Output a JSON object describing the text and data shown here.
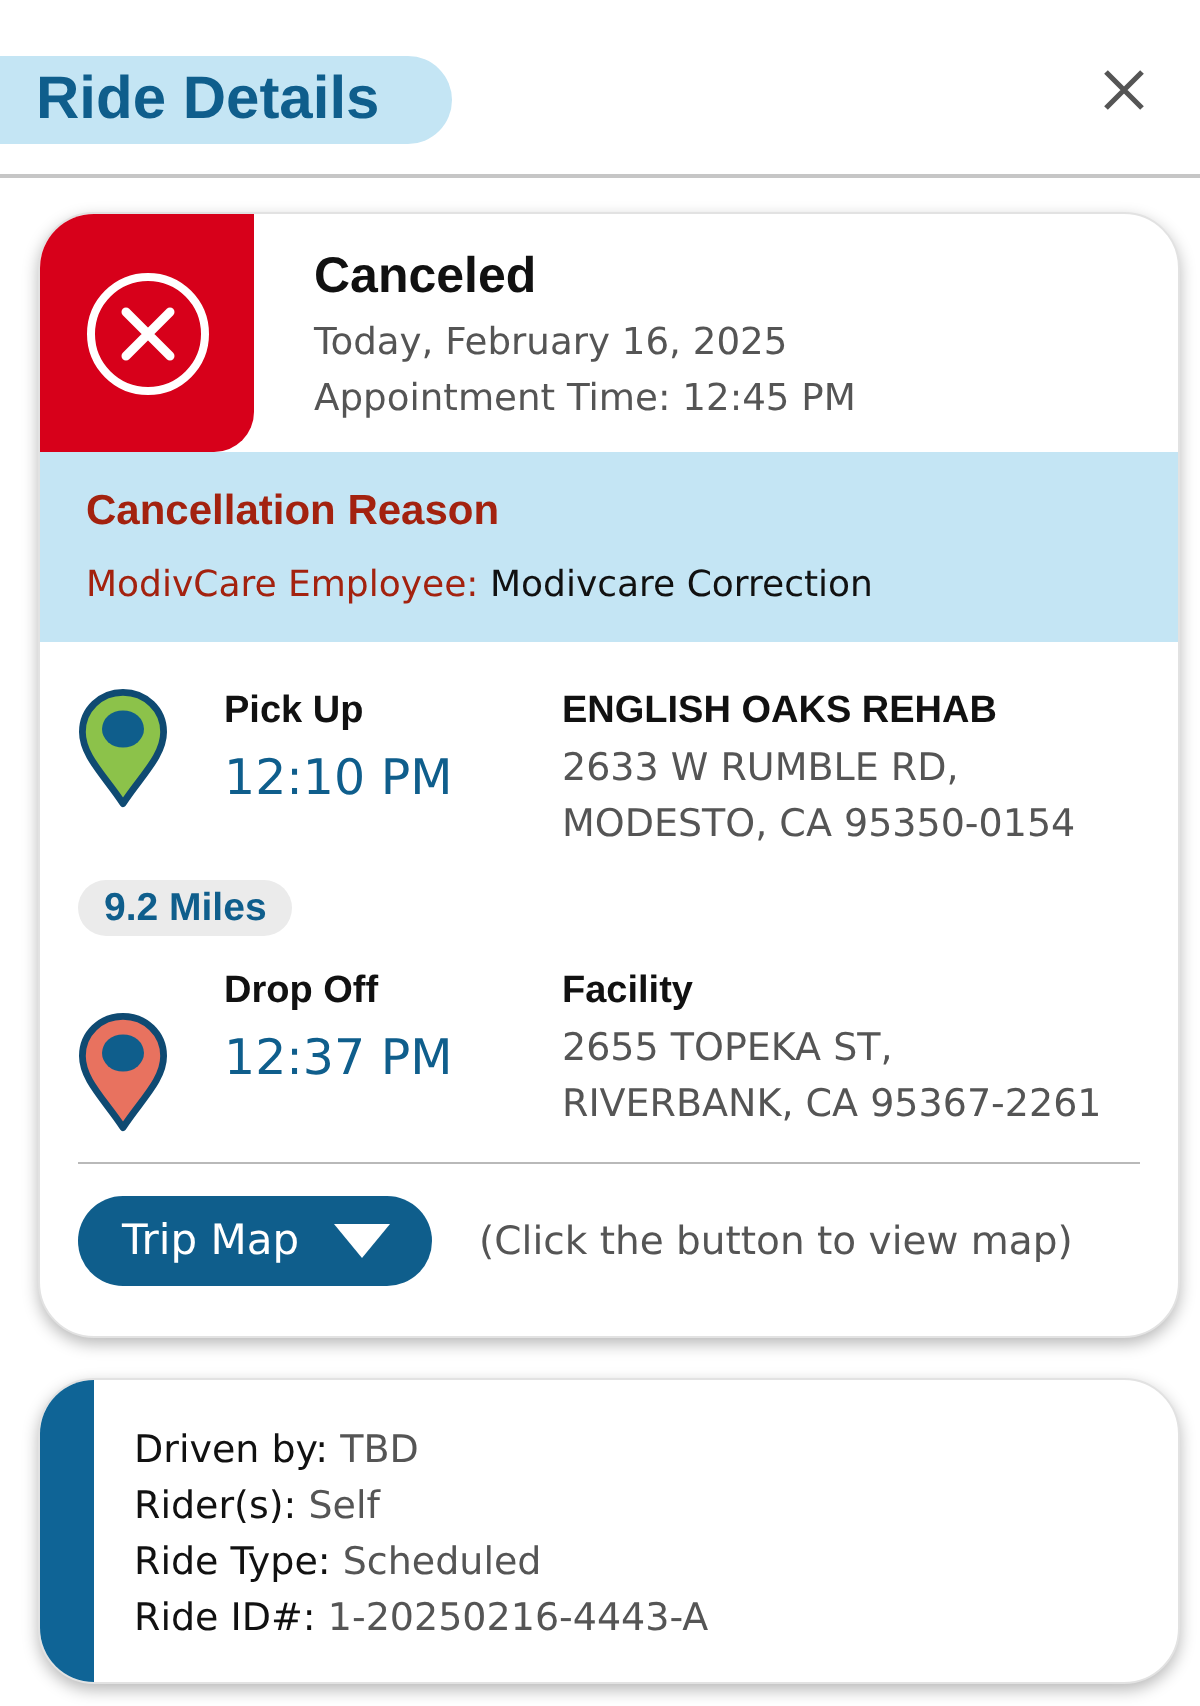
{
  "header": {
    "title": "Ride Details"
  },
  "status": {
    "kind": "canceled",
    "title": "Canceled",
    "date": "Today, February 16, 2025",
    "appointment": "Appointment Time: 12:45 PM"
  },
  "cancellation": {
    "title": "Cancellation Reason",
    "source": "ModivCare Employee:",
    "reason": "Modivcare Correction"
  },
  "trip": {
    "stops": [
      {
        "kind": "pickup",
        "label": "Pick Up",
        "time": "12:10 PM",
        "place": "ENGLISH OAKS REHAB",
        "address": [
          "2633 W RUMBLE RD,",
          "MODESTO, CA 95350-0154"
        ],
        "color": "#8cc24a"
      },
      {
        "kind": "dropoff",
        "label": "Drop Off",
        "time": "12:37 PM",
        "place": "Facility",
        "address": [
          "2655 TOPEKA ST,",
          "RIVERBANK, CA 95367-2261"
        ],
        "color": "#e8725f"
      }
    ],
    "distance": "9.2 Miles"
  },
  "map": {
    "button": "Trip Map",
    "expanded": false,
    "hint": "(Click the button to view map)"
  },
  "details": [
    {
      "label": "Driven by:",
      "value": "TBD"
    },
    {
      "label": "Rider(s):",
      "value": "Self"
    },
    {
      "label": "Ride Type:",
      "value": "Scheduled"
    },
    {
      "label": "Ride ID#:",
      "value": "1-20250216-4443-A"
    }
  ]
}
